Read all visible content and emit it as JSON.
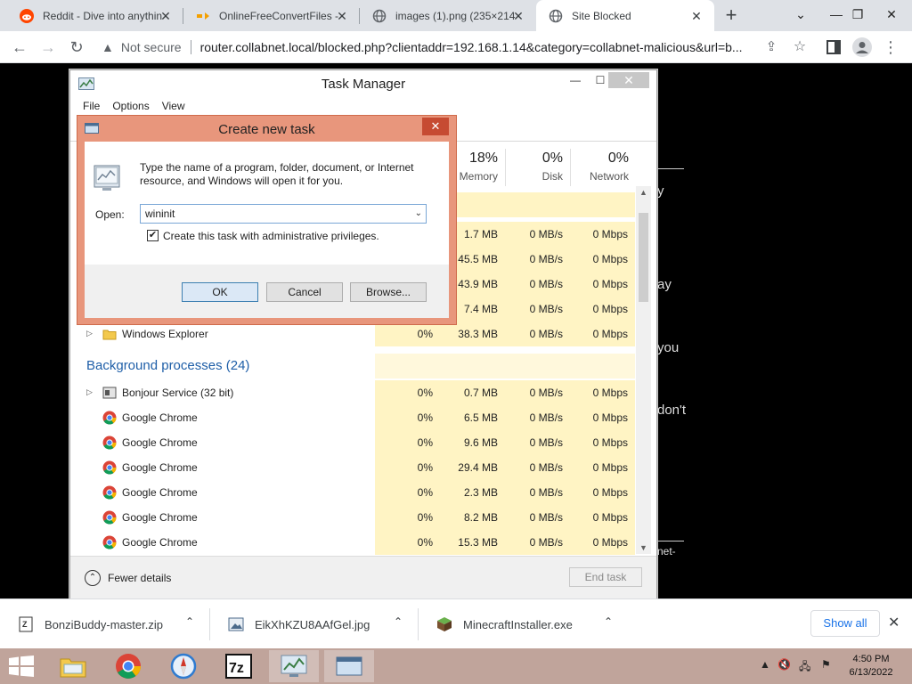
{
  "browser": {
    "tabs": [
      {
        "title": "Reddit - Dive into anythin",
        "icon": "reddit-icon"
      },
      {
        "title": "OnlineFreeConvertFiles -",
        "icon": "convert-arrow-icon"
      },
      {
        "title": "images (1).png (235×214",
        "icon": "globe-icon"
      },
      {
        "title": "Site Blocked",
        "icon": "globe-icon"
      }
    ],
    "not_secure": "Not secure",
    "url": "router.collabnet.local/blocked.php?clientaddr=192.168.1.14&category=collabnet-malicious&url=b..."
  },
  "task_manager": {
    "title": "Task Manager",
    "menu": [
      "File",
      "Options",
      "View"
    ],
    "columns": [
      {
        "pct": "18%",
        "name": "Memory"
      },
      {
        "pct": "0%",
        "name": "Disk"
      },
      {
        "pct": "0%",
        "name": "Network"
      }
    ],
    "apps_rows": [
      {
        "cpu": "",
        "mem": "1.7 MB",
        "disk": "0 MB/s",
        "net": "0 Mbps"
      },
      {
        "cpu": "",
        "mem": "45.5 MB",
        "disk": "0 MB/s",
        "net": "0 Mbps"
      },
      {
        "cpu": "",
        "mem": "43.9 MB",
        "disk": "0 MB/s",
        "net": "0 Mbps"
      },
      {
        "cpu": "",
        "mem": "7.4 MB",
        "disk": "0 MB/s",
        "net": "0 Mbps"
      },
      {
        "name": "Windows Explorer",
        "cpu": "0%",
        "mem": "38.3 MB",
        "disk": "0 MB/s",
        "net": "0 Mbps"
      }
    ],
    "bg_section": "Background processes (24)",
    "bg_rows": [
      {
        "name": "Bonjour Service (32 bit)",
        "cpu": "0%",
        "mem": "0.7 MB",
        "disk": "0 MB/s",
        "net": "0 Mbps"
      },
      {
        "name": "Google Chrome",
        "cpu": "0%",
        "mem": "6.5 MB",
        "disk": "0 MB/s",
        "net": "0 Mbps"
      },
      {
        "name": "Google Chrome",
        "cpu": "0%",
        "mem": "9.6 MB",
        "disk": "0 MB/s",
        "net": "0 Mbps"
      },
      {
        "name": "Google Chrome",
        "cpu": "0%",
        "mem": "29.4 MB",
        "disk": "0 MB/s",
        "net": "0 Mbps"
      },
      {
        "name": "Google Chrome",
        "cpu": "0%",
        "mem": "2.3 MB",
        "disk": "0 MB/s",
        "net": "0 Mbps"
      },
      {
        "name": "Google Chrome",
        "cpu": "0%",
        "mem": "8.2 MB",
        "disk": "0 MB/s",
        "net": "0 Mbps"
      },
      {
        "name": "Google Chrome",
        "cpu": "0%",
        "mem": "15.3 MB",
        "disk": "0 MB/s",
        "net": "0 Mbps"
      }
    ],
    "fewer_details": "Fewer details",
    "end_task": "End task"
  },
  "run_dialog": {
    "title": "Create new task",
    "description": "Type the name of a program, folder, document, or Internet resource, and Windows will open it for you.",
    "open_label": "Open:",
    "open_value": "wininit",
    "admin_checked": true,
    "admin_label": "Create this task with administrative privileges.",
    "ok": "OK",
    "cancel": "Cancel",
    "browse": "Browse..."
  },
  "page_fragments": [
    "y",
    "ay",
    "you",
    "don't",
    "net-"
  ],
  "downloads": [
    {
      "name": "BonziBuddy-master.zip",
      "icon": "zip-file-icon"
    },
    {
      "name": "EikXhKZU8AAfGel.jpg",
      "icon": "image-file-icon"
    },
    {
      "name": "MinecraftInstaller.exe",
      "icon": "minecraft-icon"
    }
  ],
  "show_all": "Show all",
  "clock": {
    "time": "4:50 PM",
    "date": "6/13/2022"
  }
}
